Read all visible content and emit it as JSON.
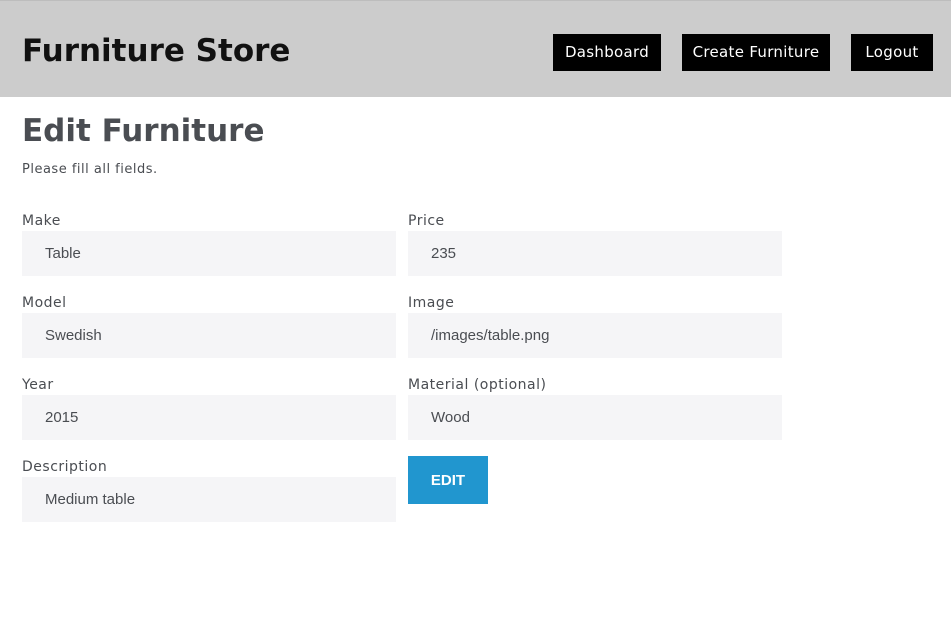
{
  "header": {
    "brand": "Furniture Store",
    "nav": {
      "dashboard": "Dashboard",
      "create": "Create Furniture",
      "logout": "Logout"
    }
  },
  "page": {
    "title": "Edit Furniture",
    "subtitle": "Please fill all fields."
  },
  "form": {
    "make": {
      "label": "Make",
      "value": "Table"
    },
    "model": {
      "label": "Model",
      "value": "Swedish"
    },
    "year": {
      "label": "Year",
      "value": "2015"
    },
    "description": {
      "label": "Description",
      "value": "Medium table"
    },
    "price": {
      "label": "Price",
      "value": "235"
    },
    "image": {
      "label": "Image",
      "value": "/images/table.png"
    },
    "material": {
      "label": "Material (optional)",
      "value": "Wood"
    },
    "submit": "EDIT"
  },
  "colors": {
    "header_bg": "#cccccc",
    "nav_button_bg": "#000000",
    "submit_button_bg": "#2196cf",
    "input_bg": "#f5f5f7"
  }
}
